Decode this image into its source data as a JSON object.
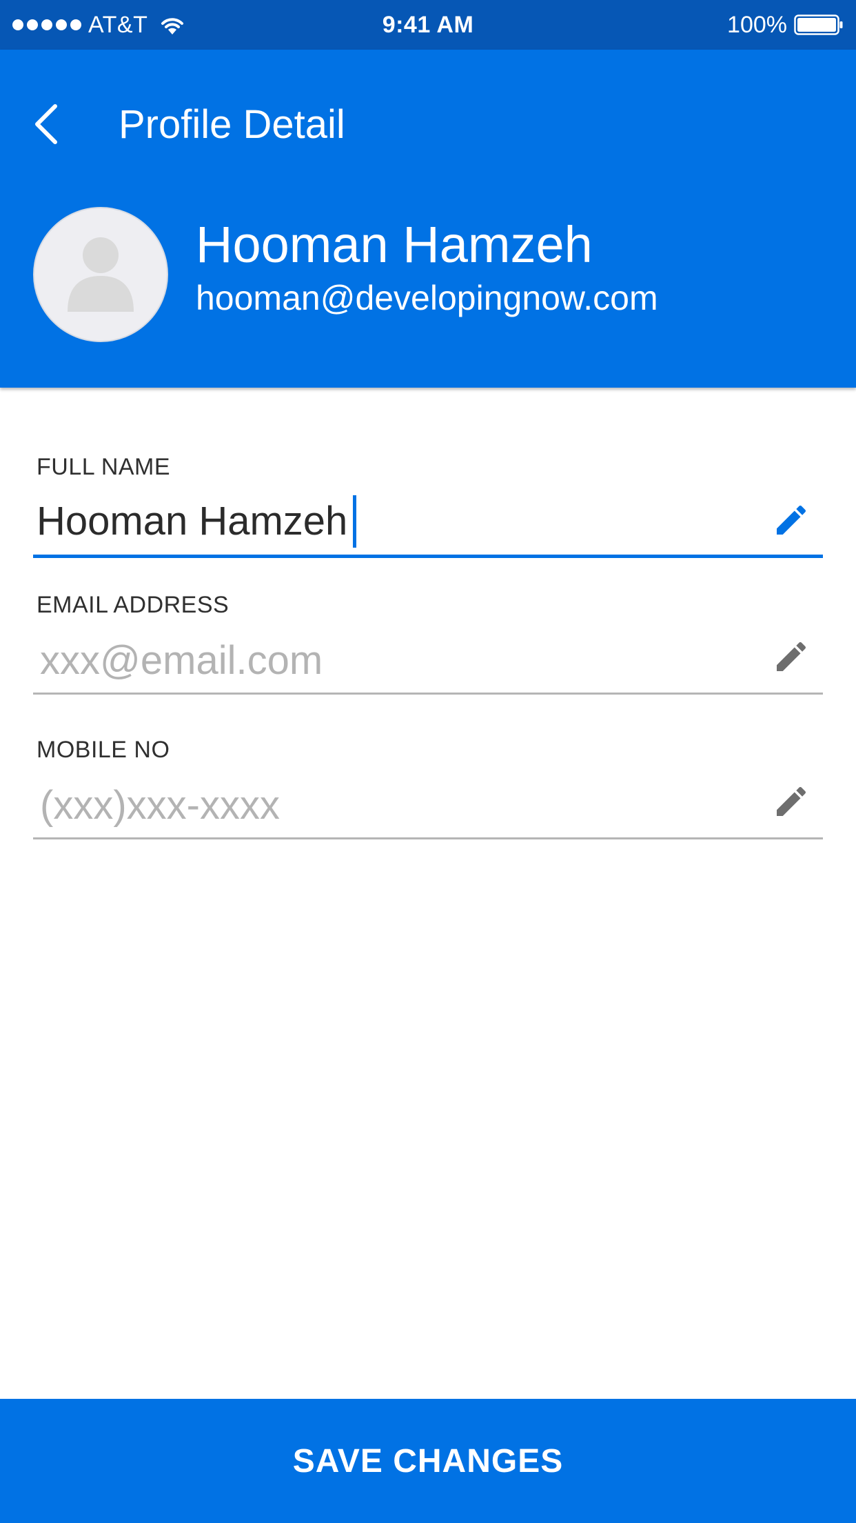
{
  "status_bar": {
    "carrier": "AT&T",
    "time": "9:41 AM",
    "battery": "100%"
  },
  "header": {
    "title": "Profile Detail",
    "back_icon": "chevron-left-icon"
  },
  "profile": {
    "name": "Hooman Hamzeh",
    "email": "hooman@developingnow.com",
    "avatar_icon": "person-placeholder-icon"
  },
  "form": {
    "full_name": {
      "label": "FULL NAME",
      "value": "Hooman Hamzeh",
      "placeholder": "",
      "focused": true,
      "icon": "pencil-icon"
    },
    "email": {
      "label": "EMAIL ADDRESS",
      "value": "",
      "placeholder": "xxx@email.com",
      "focused": false,
      "icon": "pencil-icon"
    },
    "mobile": {
      "label": "MOBILE NO",
      "value": "",
      "placeholder": "(xxx)xxx-xxxx",
      "focused": false,
      "icon": "pencil-icon"
    }
  },
  "actions": {
    "save_label": "SAVE CHANGES"
  },
  "colors": {
    "status_bar": "#0657b5",
    "primary": "#0172e4",
    "placeholder_text": "#b3b3b3",
    "idle_underline": "#b5b5b5",
    "edit_icon_idle": "#6e6e6e"
  }
}
